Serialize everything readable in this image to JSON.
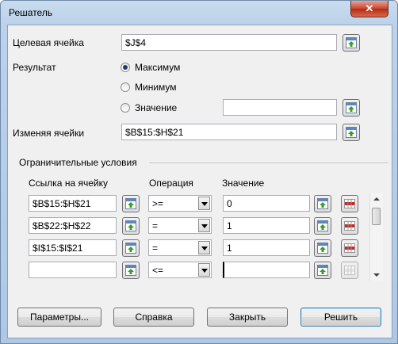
{
  "window": {
    "title": "Решатель",
    "close_glyph": "✕"
  },
  "target_cell": {
    "label": "Целевая ячейка",
    "value": "$J$4"
  },
  "result": {
    "label": "Результат",
    "options": [
      {
        "label": "Максимум",
        "selected": true
      },
      {
        "label": "Минимум",
        "selected": false
      },
      {
        "label": "Значение",
        "selected": false
      }
    ],
    "value_field": ""
  },
  "changing_cells": {
    "label": "Изменяя ячейки",
    "value": "$B$15:$H$21"
  },
  "constraints": {
    "section_label": "Ограничительные условия",
    "headers": {
      "cell_ref": "Ссылка на ячейку",
      "operator": "Операция",
      "value": "Значение"
    },
    "rows": [
      {
        "cell_ref": "$B$15:$H$21",
        "operator": ">=",
        "value": "0"
      },
      {
        "cell_ref": "$B$22:$H$22",
        "operator": "=",
        "value": "1"
      },
      {
        "cell_ref": "$I$15:$I$21",
        "operator": "=",
        "value": "1"
      },
      {
        "cell_ref": "",
        "operator": "<=",
        "value": ""
      }
    ]
  },
  "buttons": {
    "options": "Параметры...",
    "help": "Справка",
    "close": "Закрыть",
    "solve": "Решить"
  },
  "colors": {
    "shrink_arrow": "#3a9a2a",
    "delete_grid": "#cc2222"
  }
}
